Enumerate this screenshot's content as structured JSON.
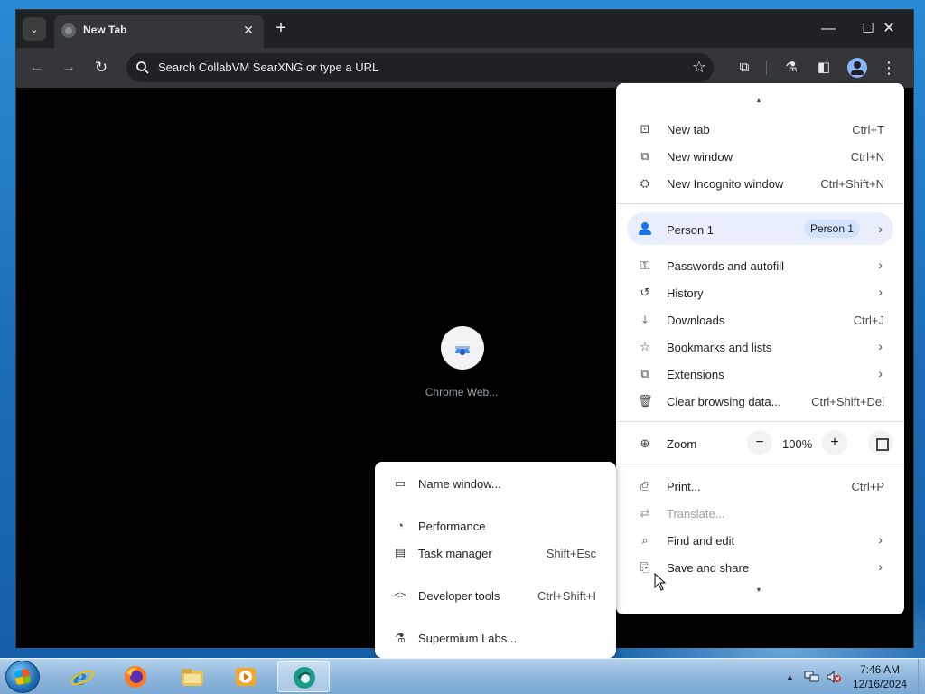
{
  "browser": {
    "tab": {
      "title": "New Tab",
      "close_glyph": "✕",
      "favicon": "globe-icon"
    },
    "tab_search_glyph": "⌄",
    "new_tab_glyph": "+",
    "window_controls": {
      "minimize": "—",
      "maximize": "☐",
      "close": "✕"
    },
    "toolbar": {
      "back_glyph": "←",
      "forward_glyph": "→",
      "reload_glyph": "↻",
      "omnibox_placeholder": "Search CollabVM SearXNG or type a URL",
      "bookmark_glyph": "☆",
      "extensions_glyph": "⧉",
      "labs_glyph": "⚗",
      "side_panel_glyph": "◧",
      "menu_glyph": "⋮"
    },
    "ntp": {
      "shortcut_label": "Chrome Web..."
    }
  },
  "menu": {
    "scroll_up_glyph": "▲",
    "scroll_down_glyph": "▼",
    "new_tab": {
      "label": "New tab",
      "shortcut": "Ctrl+T",
      "icon": "⊡"
    },
    "new_window": {
      "label": "New window",
      "shortcut": "Ctrl+N",
      "icon": "⧉"
    },
    "incognito": {
      "label": "New Incognito window",
      "shortcut": "Ctrl+Shift+N",
      "icon": "⛭"
    },
    "person": {
      "label": "Person 1",
      "badge": "Person 1",
      "chevron": "›"
    },
    "passwords": {
      "label": "Passwords and autofill",
      "icon": "⚿",
      "chevron": "›"
    },
    "history": {
      "label": "History",
      "icon": "↺",
      "chevron": "›"
    },
    "downloads": {
      "label": "Downloads",
      "shortcut": "Ctrl+J",
      "icon": "⤓"
    },
    "bookmarks": {
      "label": "Bookmarks and lists",
      "icon": "☆",
      "chevron": "›"
    },
    "extensions": {
      "label": "Extensions",
      "icon": "⧉",
      "chevron": "›"
    },
    "clear_data": {
      "label": "Clear browsing data...",
      "shortcut": "Ctrl+Shift+Del",
      "icon": "🗑"
    },
    "zoom": {
      "label": "Zoom",
      "value": "100%",
      "minus": "−",
      "plus": "+",
      "icon": "⊕"
    },
    "print": {
      "label": "Print...",
      "shortcut": "Ctrl+P",
      "icon": "⎙"
    },
    "translate": {
      "label": "Translate...",
      "icon": "⇄"
    },
    "find_edit": {
      "label": "Find and edit",
      "icon": "⌕",
      "chevron": "›"
    },
    "save_share": {
      "label": "Save and share",
      "icon": "⎘",
      "chevron": "›"
    }
  },
  "submenu": {
    "name_window": {
      "label": "Name window...",
      "icon": "▭"
    },
    "performance": {
      "label": "Performance",
      "icon": "◔"
    },
    "task_manager": {
      "label": "Task manager",
      "shortcut": "Shift+Esc",
      "icon": "▤"
    },
    "developer_tools": {
      "label": "Developer tools",
      "shortcut": "Ctrl+Shift+I",
      "icon": "<>"
    },
    "labs": {
      "label": "Supermium Labs...",
      "icon": "⚗"
    }
  },
  "taskbar": {
    "apps": [
      "internet-explorer",
      "firefox",
      "file-explorer",
      "media-player",
      "supermium"
    ],
    "tray": {
      "show_hidden": "▲",
      "network_icon": "network-icon",
      "volume_icon": "volume-muted-icon"
    },
    "clock": {
      "time": "7:46 AM",
      "date": "12/16/2024"
    }
  },
  "colors": {
    "accent": "#1a73e8",
    "chrome_dark": "#202124",
    "toolbar": "#35363a",
    "person_highlight": "#e8eefb"
  }
}
